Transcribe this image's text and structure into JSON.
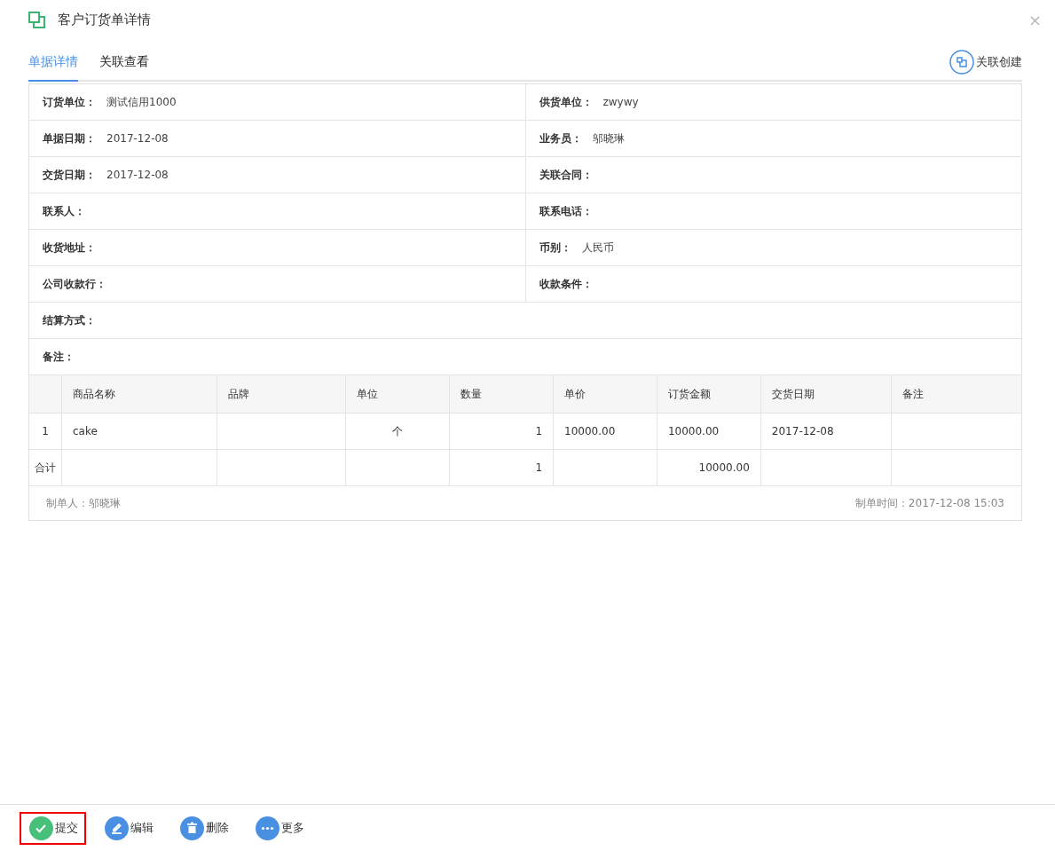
{
  "window": {
    "title": "客户订货单详情",
    "close": "×"
  },
  "tabs": [
    {
      "label": "单据详情",
      "selected": true
    },
    {
      "label": "关联查看",
      "selected": false
    }
  ],
  "link_action": {
    "label": "关联创建"
  },
  "fields": [
    [
      {
        "label": "订货单位：",
        "value": "测试信用1000"
      },
      {
        "label": "供货单位：",
        "value": "zwywy"
      }
    ],
    [
      {
        "label": "单据日期：",
        "value": "2017-12-08"
      },
      {
        "label": "业务员：",
        "value": "邬晓琳"
      }
    ],
    [
      {
        "label": "交货日期：",
        "value": "2017-12-08"
      },
      {
        "label": "关联合同："
      }
    ],
    [
      {
        "label": "联系人："
      },
      {
        "label": "联系电话："
      }
    ],
    [
      {
        "label": "收货地址："
      },
      {
        "label": "币别：",
        "value": "人民币"
      }
    ],
    [
      {
        "label": "公司收款行："
      },
      {
        "label": "收款条件："
      }
    ],
    [
      {
        "label": "结算方式："
      }
    ],
    [
      {
        "label": "备注："
      }
    ]
  ],
  "table": {
    "columns": [
      null,
      "商品名称",
      "品牌",
      "单位",
      "数量",
      "单价",
      "订货金额",
      "交货日期",
      "备注"
    ],
    "rows": [
      [
        "1",
        "cake",
        null,
        "个",
        "1",
        "10000.00",
        "10000.00",
        "2017-12-08",
        null
      ]
    ],
    "total": {
      "label": "合计",
      "quantity": "1",
      "amount": "10000.00"
    }
  },
  "footer": {
    "creator": "制单人：邬晓琳",
    "created_at": "制单时间：2017-12-08 15:03"
  },
  "actions": [
    {
      "kind": "submit",
      "label": "提交",
      "highlighted": true
    },
    {
      "kind": "edit",
      "label": "编辑",
      "highlighted": false
    },
    {
      "kind": "delete",
      "label": "删除",
      "highlighted": false
    },
    {
      "kind": "more",
      "label": "更多",
      "highlighted": false
    }
  ]
}
